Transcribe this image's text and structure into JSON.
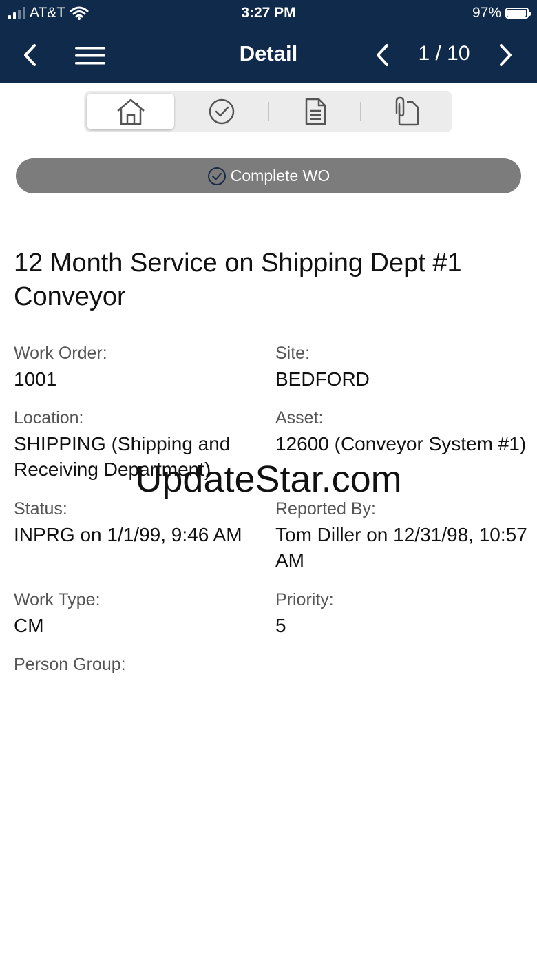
{
  "status_bar": {
    "carrier": "AT&T",
    "time": "3:27 PM",
    "battery": "97%"
  },
  "nav": {
    "title": "Detail",
    "pager": "1 / 10"
  },
  "segments": [
    {
      "icon": "home-icon",
      "active": true
    },
    {
      "icon": "check-circle-icon",
      "active": false
    },
    {
      "icon": "document-icon",
      "active": false
    },
    {
      "icon": "attachment-icon",
      "active": false
    }
  ],
  "complete_button": {
    "label": "Complete WO"
  },
  "work_order": {
    "title": "12 Month Service on Shipping Dept #1 Conveyor",
    "fields": {
      "work_order": {
        "label": "Work Order:",
        "value": "1001"
      },
      "site": {
        "label": "Site:",
        "value": "BEDFORD"
      },
      "location": {
        "label": "Location:",
        "value": "SHIPPING (Shipping and Receiving Department)"
      },
      "asset": {
        "label": "Asset:",
        "value": "12600 (Conveyor System #1)"
      },
      "status": {
        "label": "Status:",
        "value": "INPRG on 1/1/99, 9:46 AM"
      },
      "reported_by": {
        "label": "Reported By:",
        "value": "Tom Diller on 12/31/98, 10:57 AM"
      },
      "work_type": {
        "label": "Work Type:",
        "value": "CM"
      },
      "priority": {
        "label": "Priority:",
        "value": "5"
      },
      "person_group": {
        "label": "Person Group:",
        "value": ""
      }
    }
  },
  "watermark": "UpdateStar.com",
  "colors": {
    "nav_background": "#0f2a4a",
    "complete_button": "#7c7c7c",
    "segment_background": "#ececec"
  }
}
